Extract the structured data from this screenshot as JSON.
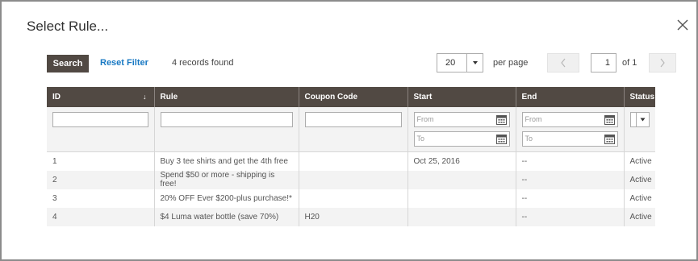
{
  "modal": {
    "title": "Select Rule..."
  },
  "toolbar": {
    "search_label": "Search",
    "reset_label": "Reset Filter",
    "records_text": "4 records found",
    "per_page_value": "20",
    "per_page_label": "per page",
    "page_value": "1",
    "of_label": "of 1",
    "prev_icon": "chevron-left-icon",
    "next_icon": "chevron-right-icon"
  },
  "grid": {
    "columns": [
      "ID",
      "Rule",
      "Coupon Code",
      "Start",
      "End",
      "Status"
    ],
    "sort_indicator": "↓",
    "filters": {
      "from_placeholder": "From",
      "to_placeholder": "To"
    },
    "rows": [
      {
        "id": "1",
        "rule": "Buy 3 tee shirts and get the 4th free",
        "coupon": "",
        "start": "Oct 25, 2016",
        "end": "--",
        "status": "Active"
      },
      {
        "id": "2",
        "rule": "Spend $50 or more - shipping is free!",
        "coupon": "",
        "start": "",
        "end": "--",
        "status": "Active"
      },
      {
        "id": "3",
        "rule": "20% OFF Ever $200-plus purchase!*",
        "coupon": "",
        "start": "",
        "end": "--",
        "status": "Active"
      },
      {
        "id": "4",
        "rule": "$4 Luma water bottle (save 70%)",
        "coupon": "H20",
        "start": "",
        "end": "--",
        "status": "Active"
      }
    ]
  },
  "colors": {
    "header_bg": "#514943",
    "link": "#1979c3",
    "alt_row": "#f3f3f3"
  }
}
